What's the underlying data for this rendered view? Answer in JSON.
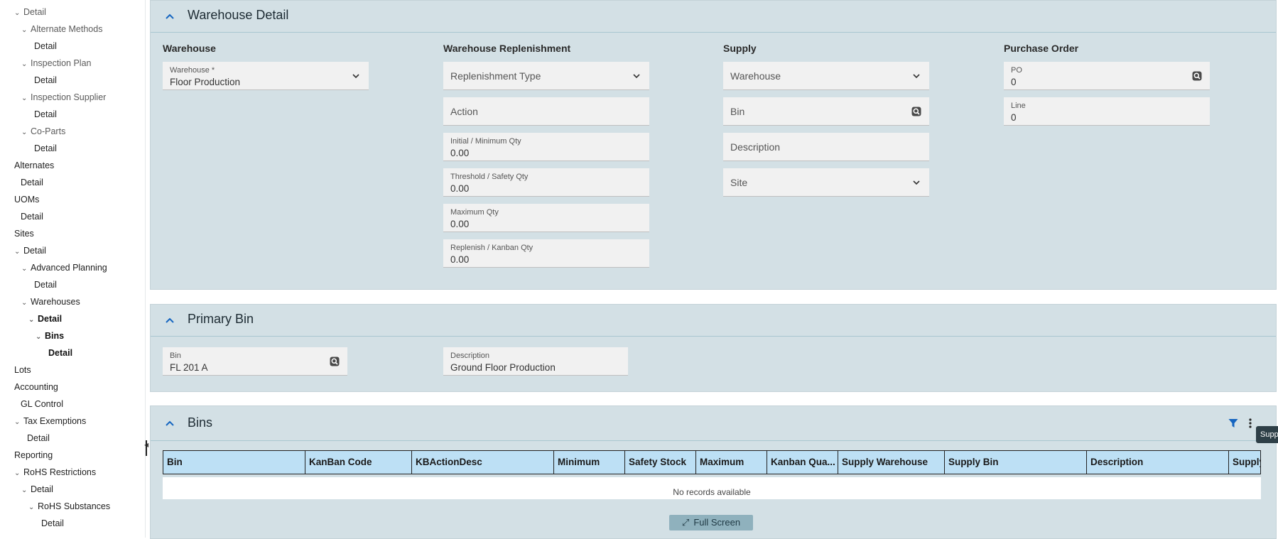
{
  "sidebar": {
    "items": [
      {
        "label": "Detail",
        "chev": true
      },
      {
        "label": "Alternate Methods",
        "chev": true
      },
      {
        "label": "Detail",
        "chev": false
      },
      {
        "label": "Inspection Plan",
        "chev": true
      },
      {
        "label": "Detail",
        "chev": false
      },
      {
        "label": "Inspection Supplier",
        "chev": true
      },
      {
        "label": "Detail",
        "chev": false
      },
      {
        "label": "Co-Parts",
        "chev": true
      },
      {
        "label": "Detail",
        "chev": false
      },
      {
        "label": "Alternates",
        "chev": false
      },
      {
        "label": "Detail",
        "chev": false
      },
      {
        "label": "UOMs",
        "chev": false
      },
      {
        "label": "Detail",
        "chev": false
      },
      {
        "label": "Sites",
        "chev": false
      },
      {
        "label": "Detail",
        "chev": true
      },
      {
        "label": "Advanced Planning",
        "chev": true
      },
      {
        "label": "Detail",
        "chev": false
      },
      {
        "label": "Warehouses",
        "chev": true
      },
      {
        "label": "Detail",
        "chev": true
      },
      {
        "label": "Bins",
        "chev": true
      },
      {
        "label": "Detail",
        "chev": false
      },
      {
        "label": "Lots",
        "chev": false
      },
      {
        "label": "Accounting",
        "chev": false
      },
      {
        "label": "GL Control",
        "chev": false
      },
      {
        "label": "Tax Exemptions",
        "chev": true
      },
      {
        "label": "Detail",
        "chev": false
      },
      {
        "label": "Reporting",
        "chev": false
      },
      {
        "label": "RoHS Restrictions",
        "chev": true
      },
      {
        "label": "Detail",
        "chev": true
      },
      {
        "label": "RoHS Substances",
        "chev": true
      },
      {
        "label": "Detail",
        "chev": false
      }
    ]
  },
  "warehouse_detail": {
    "title": "Warehouse Detail",
    "warehouse": {
      "heading": "Warehouse",
      "field_label": "Warehouse *",
      "field_value": "Floor Production"
    },
    "replenishment": {
      "heading": "Warehouse Replenishment",
      "type_placeholder": "Replenishment Type",
      "action_placeholder": "Action",
      "initial_label": "Initial / Minimum Qty",
      "initial_value": "0.00",
      "threshold_label": "Threshold / Safety Qty",
      "threshold_value": "0.00",
      "maximum_label": "Maximum Qty",
      "maximum_value": "0.00",
      "replenish_label": "Replenish / Kanban Qty",
      "replenish_value": "0.00"
    },
    "supply": {
      "heading": "Supply",
      "warehouse_placeholder": "Warehouse",
      "bin_placeholder": "Bin",
      "description_placeholder": "Description",
      "site_placeholder": "Site"
    },
    "purchase_order": {
      "heading": "Purchase Order",
      "po_label": "PO",
      "po_value": "0",
      "line_label": "Line",
      "line_value": "0"
    }
  },
  "primary_bin": {
    "title": "Primary Bin",
    "bin_label": "Bin",
    "bin_value": "FL 201 A",
    "description_label": "Description",
    "description_value": "Ground Floor Production"
  },
  "bins": {
    "title": "Bins",
    "columns": [
      "Bin",
      "KanBan Code",
      "KBActionDesc",
      "Minimum",
      "Safety Stock",
      "Maximum",
      "Kanban Qua...",
      "Supply Warehouse",
      "Supply Bin",
      "Description",
      "Supply"
    ],
    "empty_text": "No records available",
    "fullscreen_label": "Full Screen"
  },
  "tooltip": {
    "text": "Supp"
  },
  "colors": {
    "panel_bg": "#d3e0e5",
    "grid_header": "#bde0f5",
    "accent": "#1565c0",
    "button_bg": "#8fb1bd"
  }
}
